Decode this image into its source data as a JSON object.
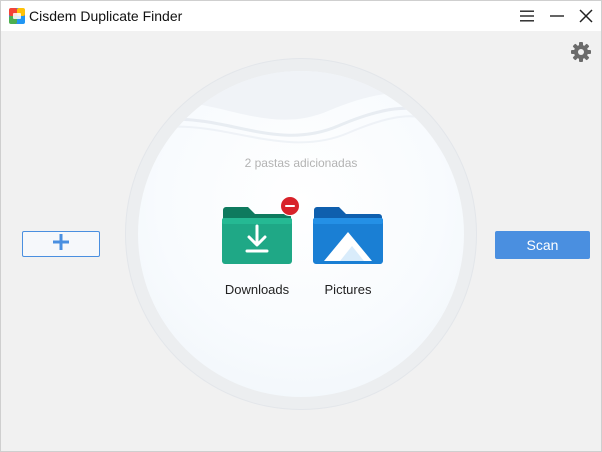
{
  "window": {
    "title": "Cisdem Duplicate Finder"
  },
  "titlebar": {
    "icons": [
      "app-icon",
      "menu-icon",
      "minimize-icon",
      "close-icon"
    ]
  },
  "toolbar": {
    "settings_icon": "gear-icon"
  },
  "drop_area": {
    "status_text": "2 pastas adicionadas",
    "folders": [
      {
        "label": "Downloads",
        "icon": "downloads-folder-icon",
        "removable": true
      },
      {
        "label": "Pictures",
        "icon": "pictures-folder-icon",
        "removable": false
      }
    ]
  },
  "actions": {
    "add_icon": "plus-icon",
    "scan_label": "Scan"
  },
  "colors": {
    "accent": "#4a8fe0",
    "remove_badge": "#d8222a",
    "downloads_folder": "#1fa886",
    "pictures_folder": "#1a7fd4"
  }
}
